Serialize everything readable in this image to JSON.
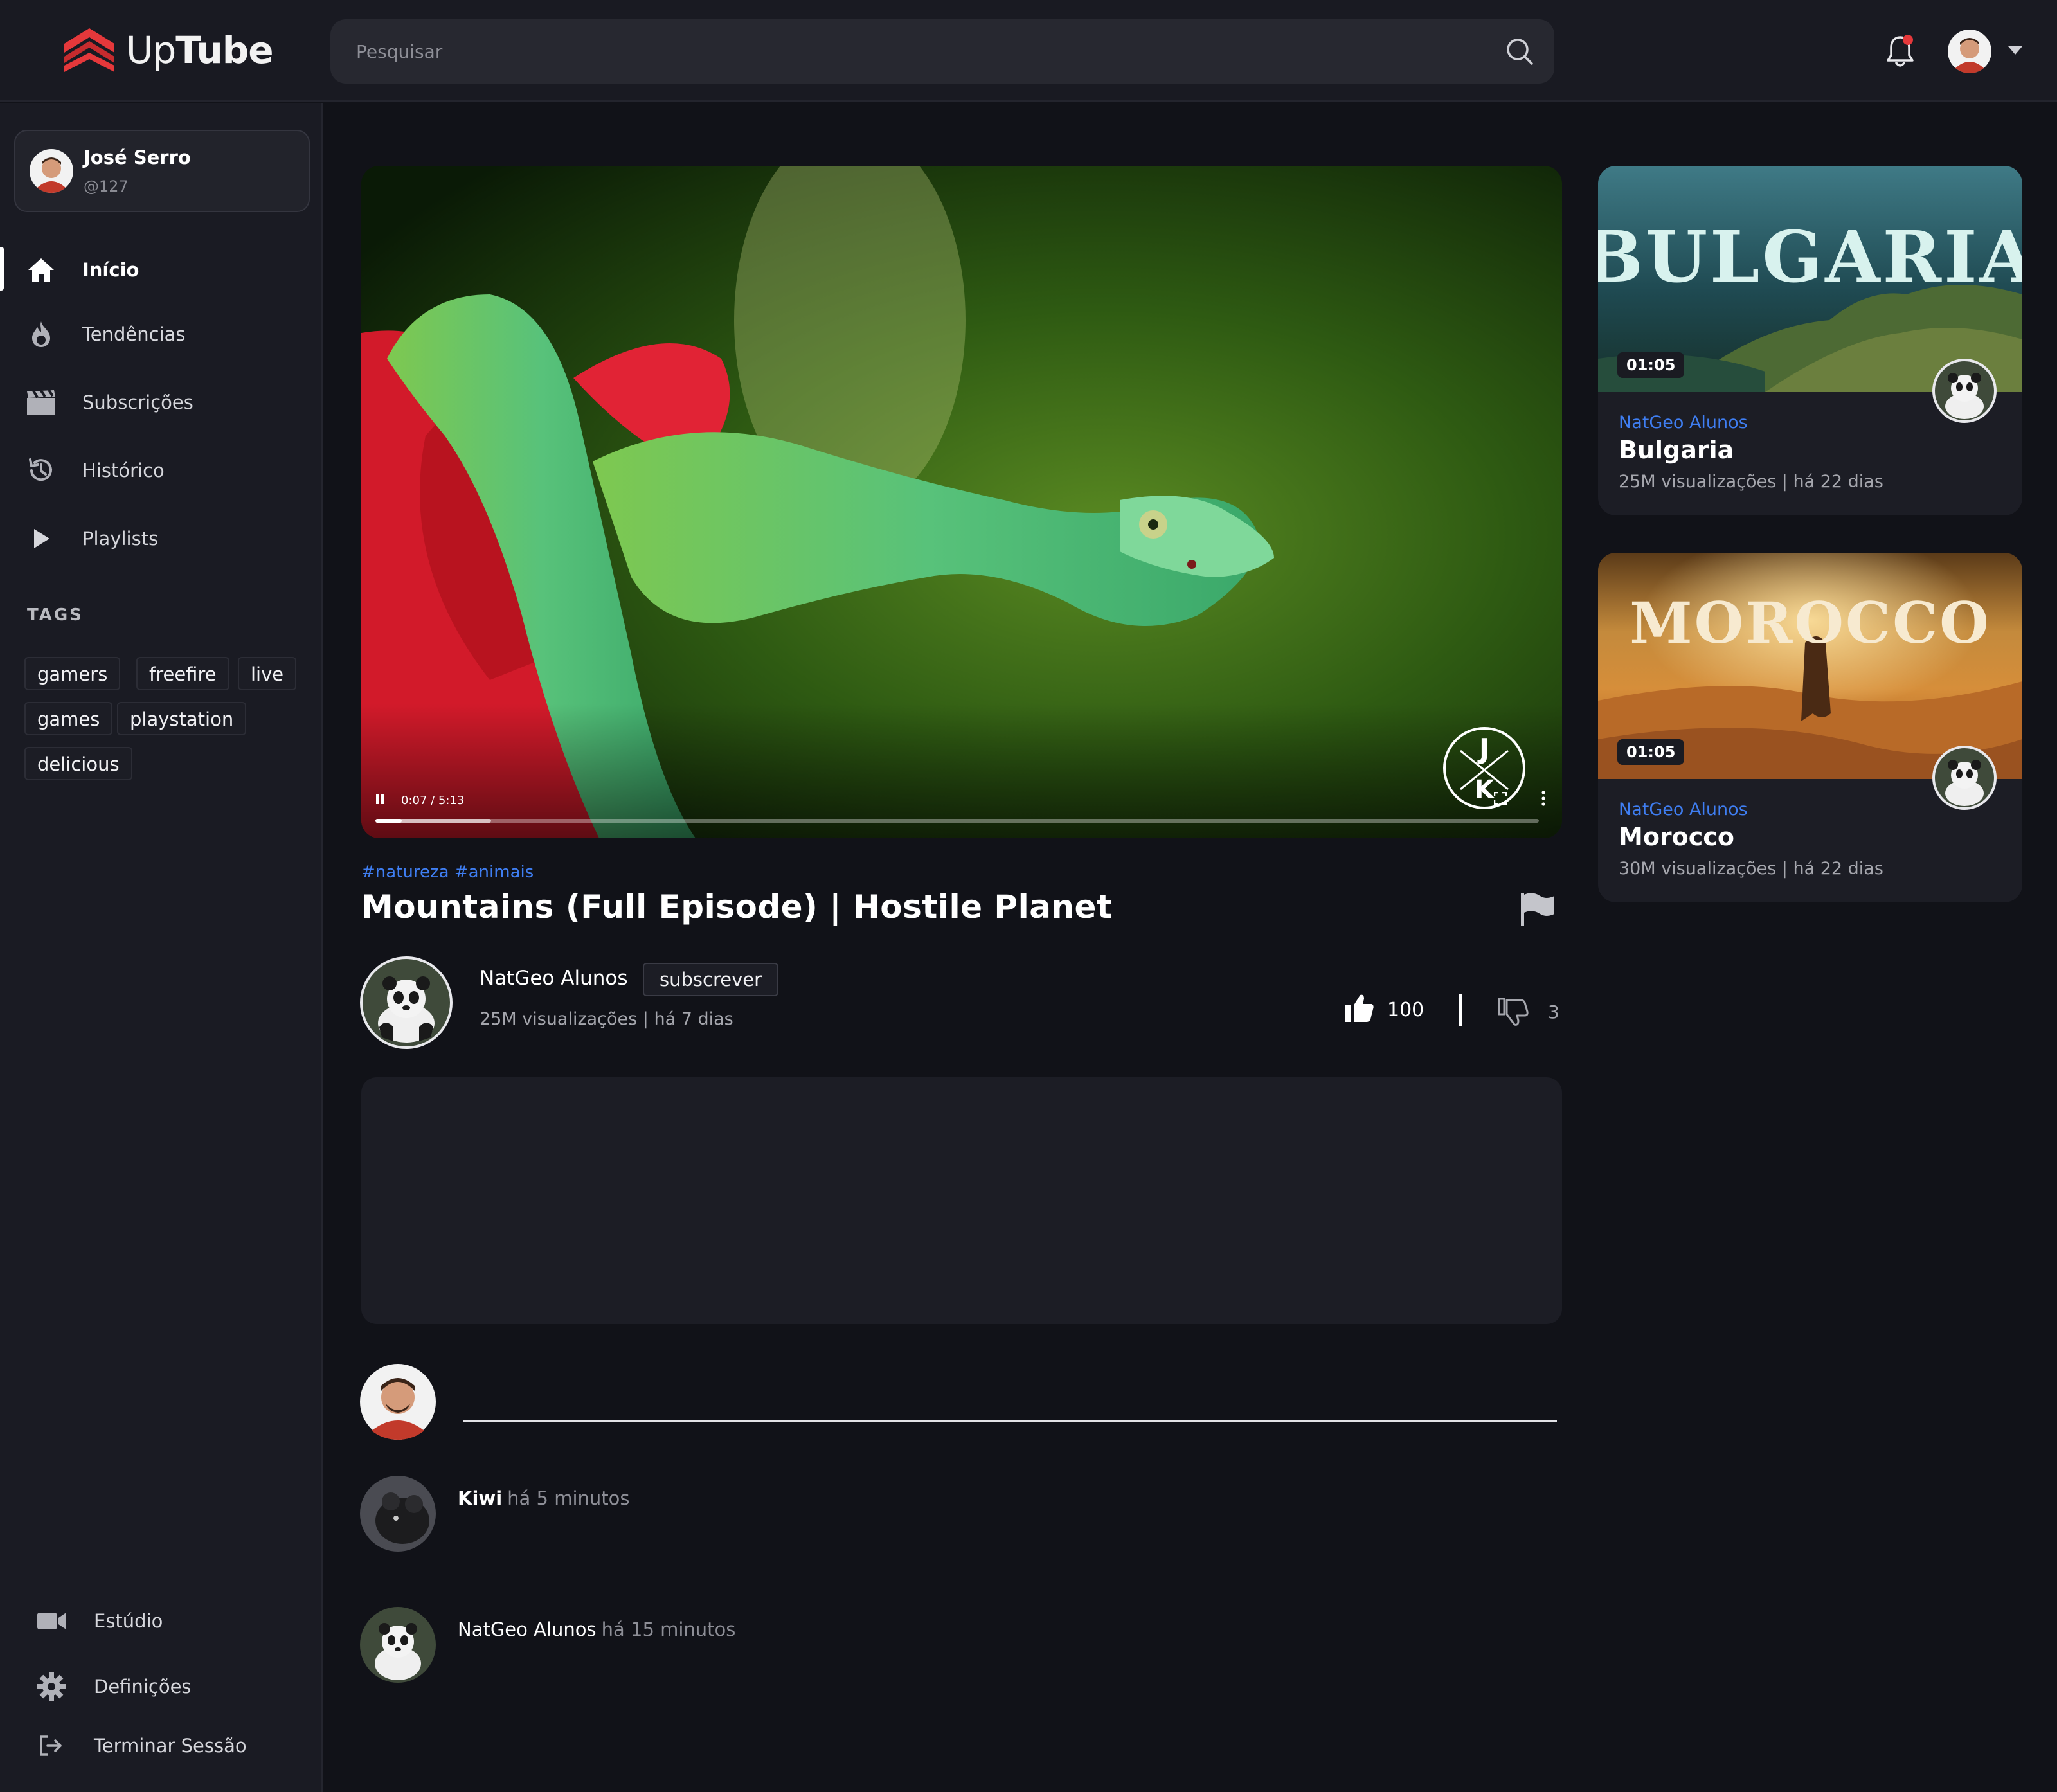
{
  "brand": {
    "name_light": "Up",
    "name_bold": "Tube",
    "accent": "#e5383b"
  },
  "search": {
    "placeholder": "Pesquisar"
  },
  "user": {
    "name": "José Serro",
    "handle": "@127"
  },
  "nav": [
    {
      "label": "Início",
      "icon": "home-icon",
      "active": true
    },
    {
      "label": "Tendências",
      "icon": "fire-icon"
    },
    {
      "label": "Subscrições",
      "icon": "clapperboard-icon"
    },
    {
      "label": "Histórico",
      "icon": "history-icon"
    },
    {
      "label": "Playlists",
      "icon": "play-icon"
    }
  ],
  "tags": {
    "title": "TAGS",
    "items": [
      "gamers",
      "freefire",
      "live",
      "games",
      "playstation",
      "delicious"
    ]
  },
  "footer_nav": [
    {
      "label": "Estúdio",
      "icon": "video-camera-icon"
    },
    {
      "label": "Definições",
      "icon": "gear-icon"
    },
    {
      "label": "Terminar Sessão",
      "icon": "logout-icon"
    }
  ],
  "player": {
    "time": "0:07 / 5:13",
    "progress": 0.0224
  },
  "video": {
    "hashtags": "#natureza #animais",
    "title": "Mountains (Full Episode) | Hostile Planet",
    "channel": "NatGeo Alunos",
    "subscribe_label": "subscrever",
    "meta": "25M visualizações | há 7 dias",
    "likes": "100",
    "dislikes": "3"
  },
  "comments": [
    {
      "author": "Kiwi",
      "time": "há 5 minutos"
    },
    {
      "author": "NatGeo Alunos",
      "time": "há 15 minutos"
    }
  ],
  "recommended": [
    {
      "channel": "NatGeo Alunos",
      "title": "Bulgaria",
      "meta": "25M visualizações | há 22 dias",
      "duration": "01:05",
      "thumb_text": "BULGARIA"
    },
    {
      "channel": "NatGeo Alunos",
      "title": "Morocco",
      "meta": "30M visualizações | há 22 dias",
      "duration": "01:05",
      "thumb_text": "MOROCCO"
    }
  ]
}
